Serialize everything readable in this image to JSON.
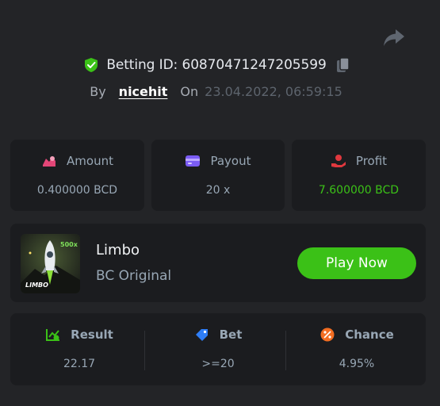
{
  "header": {
    "betting_id_label": "Betting ID: 60870471247205599",
    "by_label": "By",
    "username": "nicehit",
    "on_label": "On",
    "timestamp": "23.04.2022, 06:59:15"
  },
  "stats": {
    "amount": {
      "label": "Amount",
      "value": "0.400000 BCD"
    },
    "payout": {
      "label": "Payout",
      "value": "20 x"
    },
    "profit": {
      "label": "Profit",
      "value": "7.600000 BCD"
    }
  },
  "game": {
    "name": "Limbo",
    "subtitle": "BC Original",
    "thumb_badge": "500x",
    "thumb_label": "LIMBO",
    "play_label": "Play Now"
  },
  "result": {
    "result": {
      "label": "Result",
      "value": "22.17"
    },
    "bet": {
      "label": "Bet",
      "value": ">=20"
    },
    "chance": {
      "label": "Chance",
      "value": "4.95%"
    }
  },
  "colors": {
    "background": "#232427",
    "card": "#1b1c1f",
    "accent_green": "#3bc117",
    "text_muted": "#98a7b5",
    "profit_icon": "#e0383e",
    "payout_icon": "#7b5cf5",
    "amount_icon": "#e34677",
    "bet_icon": "#2f7ef7",
    "chance_icon": "#f36d21"
  },
  "icons": [
    "share-icon",
    "shield-check-icon",
    "copy-icon",
    "amount-icon",
    "wallet-icon",
    "profit-hand-icon",
    "result-chart-icon",
    "bet-tag-icon",
    "percent-icon",
    "rocket-icon"
  ]
}
